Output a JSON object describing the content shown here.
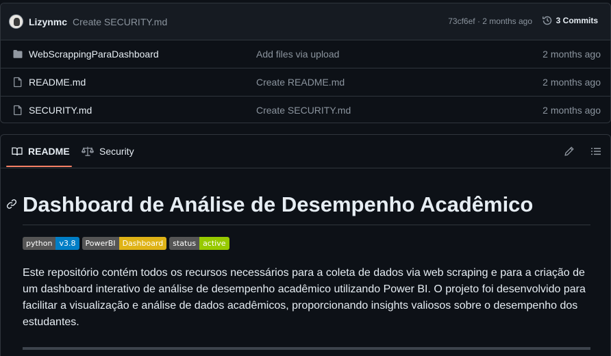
{
  "commit_bar": {
    "author": "Lizynmc",
    "message": "Create SECURITY.md",
    "meta": "73cf6ef · 2 months ago",
    "commits_label": "3 Commits"
  },
  "files": [
    {
      "type": "folder",
      "icon": "folder-icon",
      "name": "WebScrappingParaDashboard",
      "commit": "Add files via upload",
      "date": "2 months ago"
    },
    {
      "type": "file",
      "icon": "file-icon",
      "name": "README.md",
      "commit": "Create README.md",
      "date": "2 months ago"
    },
    {
      "type": "file",
      "icon": "file-icon",
      "name": "SECURITY.md",
      "commit": "Create SECURITY.md",
      "date": "2 months ago"
    }
  ],
  "readme_tabs": {
    "readme_label": "README",
    "security_label": "Security"
  },
  "readme": {
    "title": "Dashboard de Análise de Desempenho Acadêmico",
    "badges": [
      {
        "label": "python",
        "value": "v3.8",
        "color": "#007ec6"
      },
      {
        "label": "PowerBI",
        "value": "Dashboard",
        "color": "#dfb317"
      },
      {
        "label": "status",
        "value": "active",
        "color": "#97ca00"
      }
    ],
    "paragraph": "Este repositório contém todos os recursos necessários para a coleta de dados via web scraping e para a criação de um dashboard interativo de análise de desempenho acadêmico utilizando Power BI. O projeto foi desenvolvido para facilitar a visualização e análise de dados acadêmicos, proporcionando insights valiosos sobre o desempenho dos estudantes."
  },
  "colors": {
    "background": "#0d1117",
    "border": "#30363d",
    "muted_text": "#8b949e",
    "active_tab_underline": "#f78166"
  }
}
